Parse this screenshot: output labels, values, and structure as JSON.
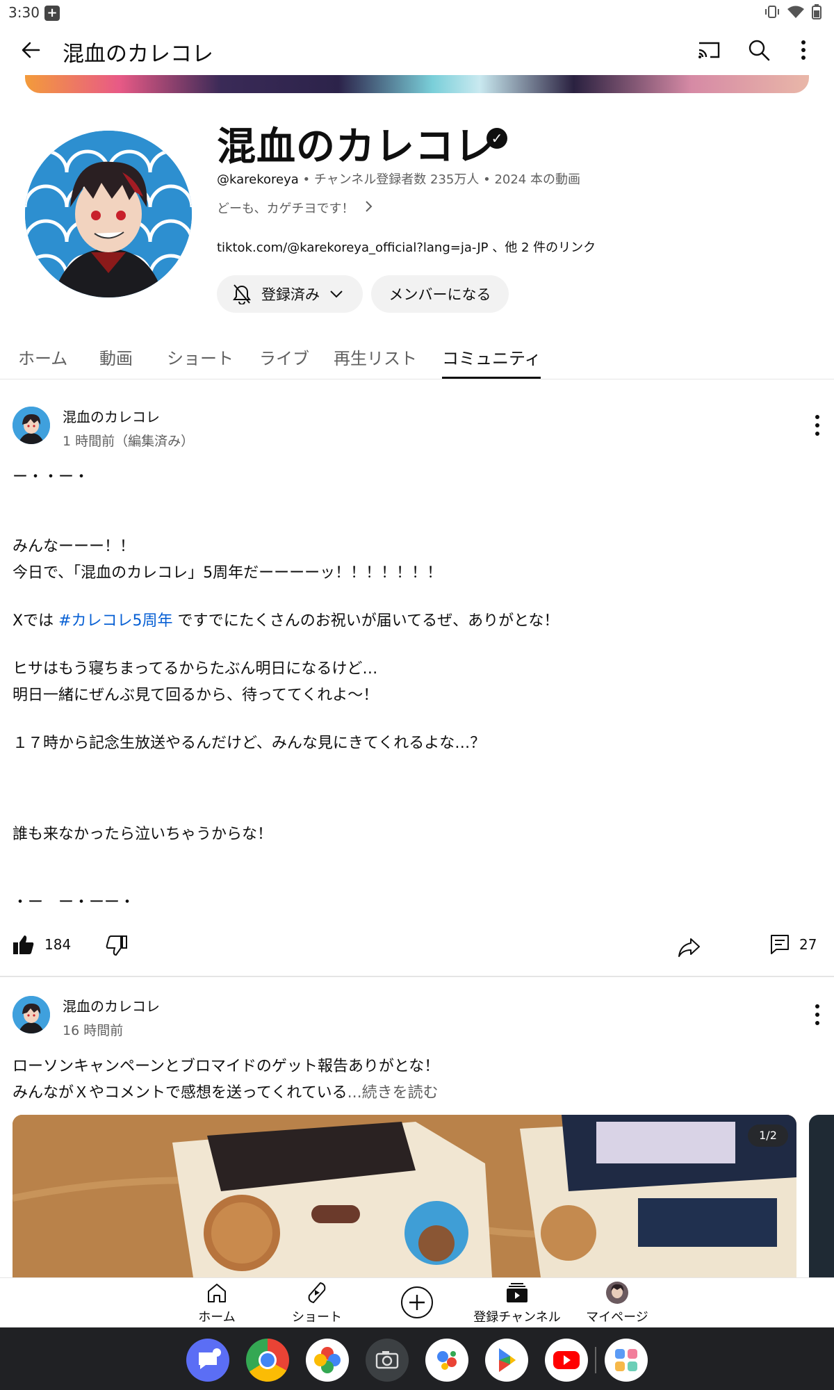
{
  "status": {
    "time": "3:30"
  },
  "appbar": {
    "title": "混血のカレコレ"
  },
  "channel": {
    "name": "混血のカレコレ",
    "handle": "@karekoreya",
    "stats": " • チャンネル登録者数 235万人 • 2024 本の動画",
    "description": "どーも、カゲチヨです！",
    "links": "tiktok.com/@karekoreya_official?lang=ja-JP 、他 2 件のリンク",
    "subscribed_label": "登録済み",
    "member_label": "メンバーになる"
  },
  "tabs": [
    "ホーム",
    "動画",
    "ショート",
    "ライブ",
    "再生リスト",
    "コミュニティ"
  ],
  "post1": {
    "author": "混血のカレコレ",
    "time": "1 時間前（編集済み）",
    "line1": "ー・・ー・",
    "line2": "みんなーーー！！",
    "line3": "今日で、「混血のカレコレ」5周年だーーーーッ！！！！！！！",
    "line4_pre": "Xでは ",
    "hashtag": "#カレコレ5周年",
    "line4_post": " ですでにたくさんのお祝いが届いてるぜ、ありがとな！",
    "line5": "ヒサはもう寝ちまってるからたぶん明日になるけど…",
    "line6": "明日一緒にぜんぶ見て回るから、待っててくれよ〜！",
    "line7": "１７時から記念生放送やるんだけど、みんな見にきてくれるよな…？",
    "line8": "誰も来なかったら泣いちゃうからな！",
    "line9": "・ー　ー・ーー・",
    "likes": "184",
    "comments": "27"
  },
  "post2": {
    "author": "混血のカレコレ",
    "time": "16 時間前",
    "line1": "ローソンキャンペーンとブロマイドのゲット報告ありがとな！",
    "line2": "みんながＸやコメントで感想を送ってくれている",
    "more": "...続きを読む",
    "counter": "1/2"
  },
  "bottomnav": {
    "home": "ホーム",
    "shorts": "ショート",
    "subscriptions": "登録チャンネル",
    "mypage": "マイページ"
  }
}
